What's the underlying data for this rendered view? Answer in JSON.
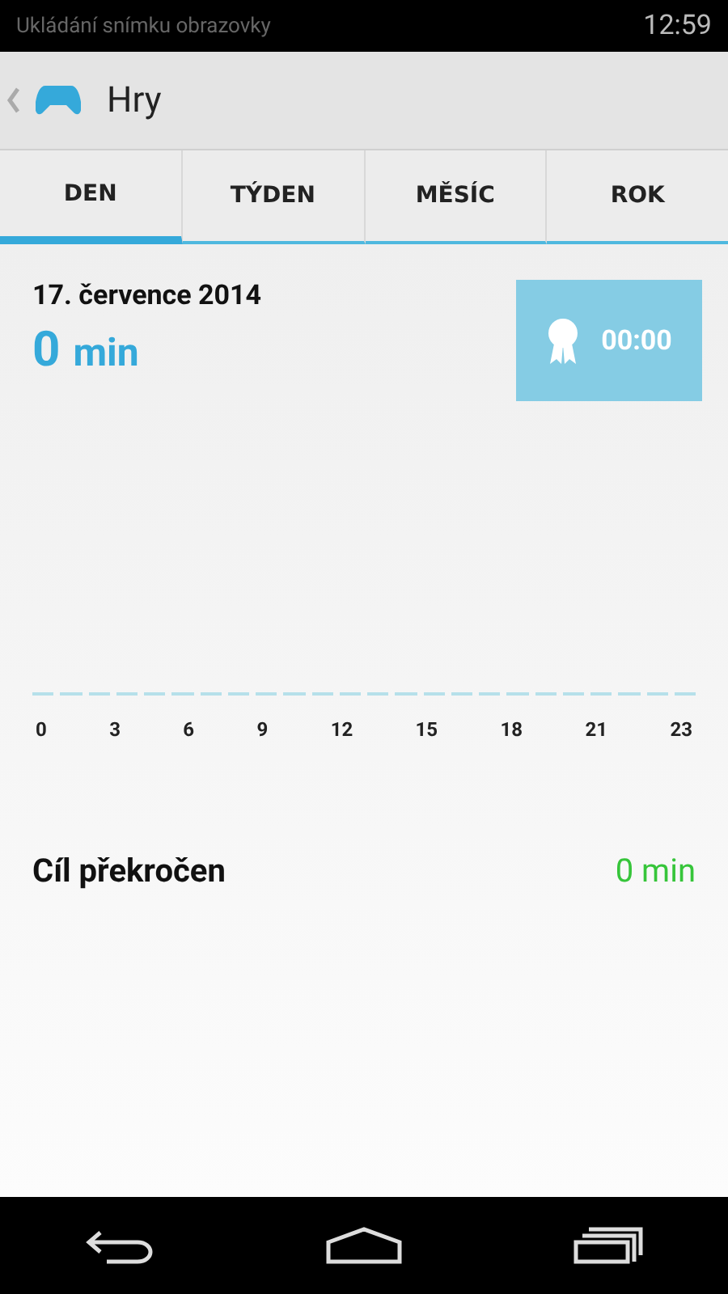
{
  "status_bar": {
    "notification": "Ukládání snímku obrazovky",
    "time": "12:59"
  },
  "app_bar": {
    "title": "Hry"
  },
  "tabs": [
    {
      "label": "DEN",
      "selected": true
    },
    {
      "label": "TÝDEN",
      "selected": false
    },
    {
      "label": "MĚSÍC",
      "selected": false
    },
    {
      "label": "ROK",
      "selected": false
    }
  ],
  "summary": {
    "date": "17. července 2014",
    "total_value": "0",
    "total_unit": "min",
    "badge_time": "00:00"
  },
  "chart": {
    "x_labels": [
      "0",
      "3",
      "6",
      "9",
      "12",
      "15",
      "18",
      "21",
      "23"
    ]
  },
  "goal": {
    "label": "Cíl překročen",
    "value": "0 min"
  }
}
